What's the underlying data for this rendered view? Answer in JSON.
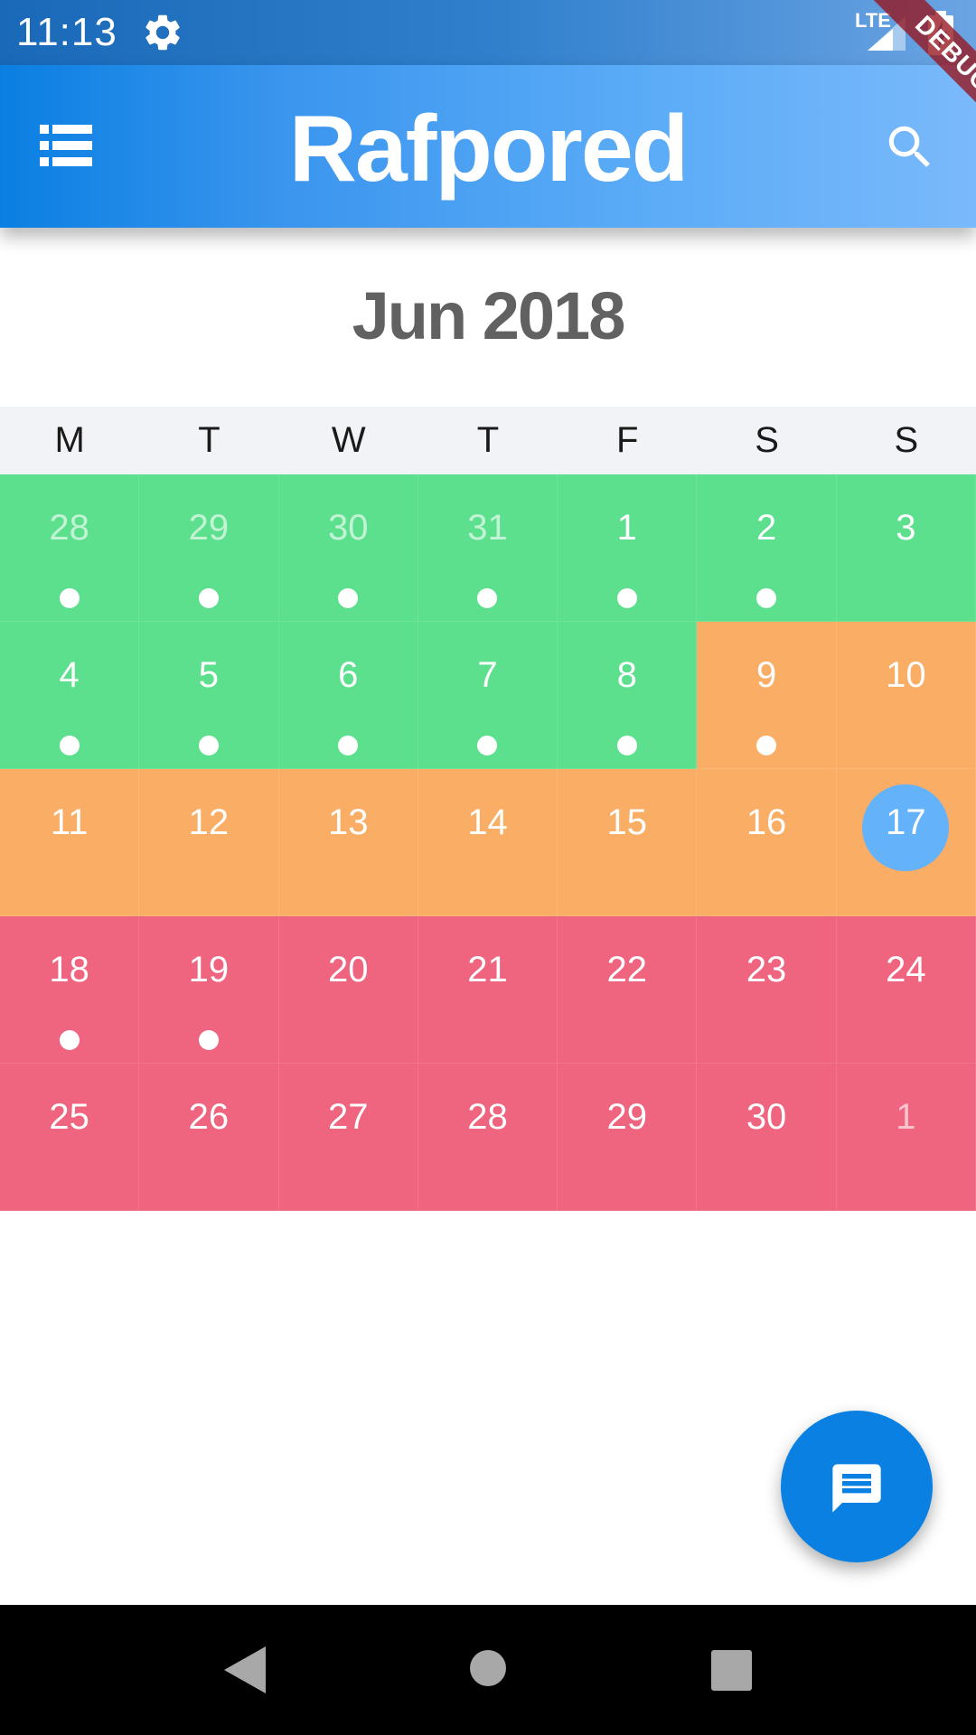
{
  "status_bar": {
    "time": "11:13",
    "network": "LTE"
  },
  "app_bar": {
    "title": "Rafpored",
    "debug_banner": "DEBUG"
  },
  "calendar": {
    "month_label": "Jun 2018",
    "weekdays": [
      "M",
      "T",
      "W",
      "T",
      "F",
      "S",
      "S"
    ],
    "colors": {
      "green": "#5ce08e",
      "orange": "#faad65",
      "red": "#ef647e",
      "today": "#64b2fa"
    },
    "days": [
      {
        "label": "28",
        "color": "green",
        "dot": true,
        "other_month": true
      },
      {
        "label": "29",
        "color": "green",
        "dot": true,
        "other_month": true
      },
      {
        "label": "30",
        "color": "green",
        "dot": true,
        "other_month": true
      },
      {
        "label": "31",
        "color": "green",
        "dot": true,
        "other_month": true
      },
      {
        "label": "1",
        "color": "green",
        "dot": true
      },
      {
        "label": "2",
        "color": "green",
        "dot": true
      },
      {
        "label": "3",
        "color": "green",
        "dot": false
      },
      {
        "label": "4",
        "color": "green",
        "dot": true
      },
      {
        "label": "5",
        "color": "green",
        "dot": true
      },
      {
        "label": "6",
        "color": "green",
        "dot": true
      },
      {
        "label": "7",
        "color": "green",
        "dot": true
      },
      {
        "label": "8",
        "color": "green",
        "dot": true
      },
      {
        "label": "9",
        "color": "orange",
        "dot": true
      },
      {
        "label": "10",
        "color": "orange",
        "dot": false
      },
      {
        "label": "11",
        "color": "orange",
        "dot": false
      },
      {
        "label": "12",
        "color": "orange",
        "dot": false
      },
      {
        "label": "13",
        "color": "orange",
        "dot": false
      },
      {
        "label": "14",
        "color": "orange",
        "dot": false
      },
      {
        "label": "15",
        "color": "orange",
        "dot": false
      },
      {
        "label": "16",
        "color": "orange",
        "dot": false
      },
      {
        "label": "17",
        "color": "orange",
        "dot": false,
        "today": true
      },
      {
        "label": "18",
        "color": "red",
        "dot": true
      },
      {
        "label": "19",
        "color": "red",
        "dot": true
      },
      {
        "label": "20",
        "color": "red",
        "dot": false
      },
      {
        "label": "21",
        "color": "red",
        "dot": false
      },
      {
        "label": "22",
        "color": "red",
        "dot": false
      },
      {
        "label": "23",
        "color": "red",
        "dot": false
      },
      {
        "label": "24",
        "color": "red",
        "dot": false
      },
      {
        "label": "25",
        "color": "red",
        "dot": false
      },
      {
        "label": "26",
        "color": "red",
        "dot": false
      },
      {
        "label": "27",
        "color": "red",
        "dot": false
      },
      {
        "label": "28",
        "color": "red",
        "dot": false
      },
      {
        "label": "29",
        "color": "red",
        "dot": false
      },
      {
        "label": "30",
        "color": "red",
        "dot": false
      },
      {
        "label": "1",
        "color": "red",
        "dot": false,
        "other_month": true
      }
    ]
  },
  "icons": {
    "settings": "settings-icon",
    "menu": "list-icon",
    "search": "search-icon",
    "fab": "chat-icon",
    "nav_back": "back-triangle-icon",
    "nav_home": "home-circle-icon",
    "nav_recents": "recents-square-icon"
  }
}
